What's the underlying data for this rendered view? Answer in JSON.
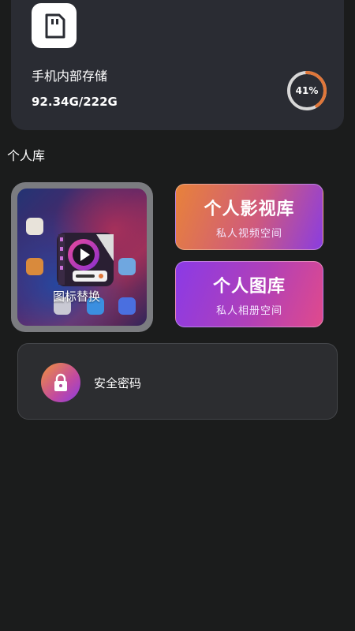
{
  "storage": {
    "title": "手机内部存储",
    "size_text": "92.34G/222G",
    "percent_text": "41%",
    "percent_value": 0.41,
    "ring_color": "#e0773a",
    "track_color": "#d8d8d8",
    "icon": "sd-card-icon"
  },
  "personal_library": {
    "section_title": "个人库",
    "icon_replace": {
      "label": "图标替换",
      "icon": "video-player-app-icon"
    },
    "video_library": {
      "title": "个人影视库",
      "subtitle": "私人视频空间"
    },
    "gallery": {
      "title": "个人图库",
      "subtitle": "私人相册空间"
    }
  },
  "security": {
    "label": "安全密码",
    "icon": "lock-icon"
  }
}
